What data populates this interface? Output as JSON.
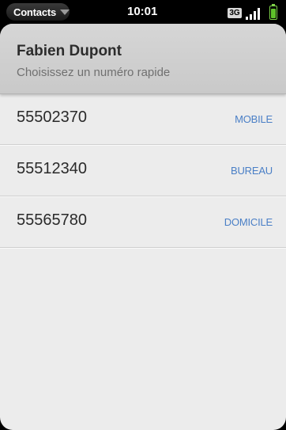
{
  "status_bar": {
    "app_name": "Contacts",
    "time": "10:01",
    "network": "3G",
    "signal_level": 4,
    "battery_level": 0.85
  },
  "header": {
    "name": "Fabien Dupont",
    "subtitle": "Choisissez un numéro rapide"
  },
  "numbers": [
    {
      "number": "55502370",
      "type": "MOBILE"
    },
    {
      "number": "55512340",
      "type": "BUREAU"
    },
    {
      "number": "55565780",
      "type": "DOMICILE"
    }
  ],
  "colors": {
    "accent": "#4a7fc6",
    "battery": "#5fc22a"
  }
}
